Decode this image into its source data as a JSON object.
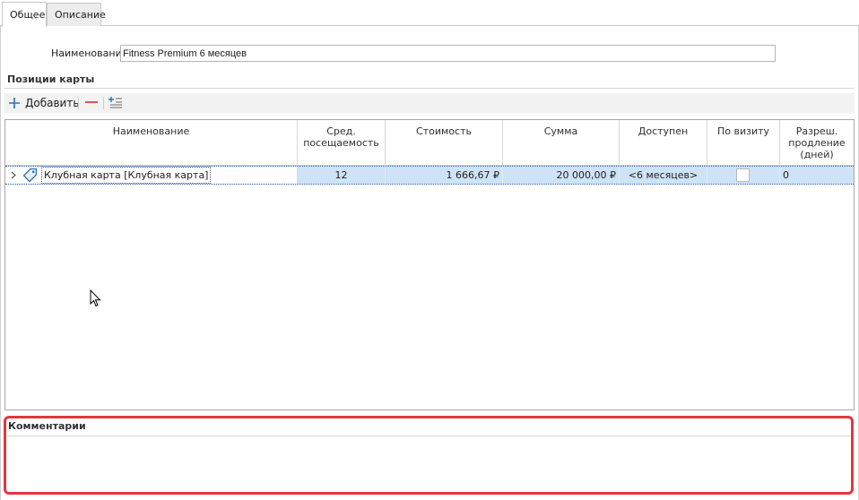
{
  "tabs": [
    {
      "label": "Общее",
      "active": true
    },
    {
      "label": "Описание",
      "active": false
    }
  ],
  "name_field": {
    "label": "Наименование:",
    "value": "Fitness Premium 6 месяцев"
  },
  "positions_group": {
    "title": "Позиции карты"
  },
  "toolbar": {
    "add_label": "Добавить"
  },
  "grid": {
    "columns": [
      "Наименование",
      "Сред. посещаемость",
      "Стоимость",
      "Сумма",
      "Доступен",
      "По визиту",
      "Разреш. продление (дней)"
    ],
    "rows": [
      {
        "name": "Клубная карта [Клубная карта]",
        "attendance": "12",
        "cost": "1 666,67 ₽",
        "sum": "20 000,00 ₽",
        "available": "<6 месяцев>",
        "per_visit": false,
        "extension": "0"
      }
    ]
  },
  "comments_group": {
    "title": "Комментарии"
  },
  "colors": {
    "selection_row": "#cfe3f7",
    "highlight_border": "#e0383e",
    "add_icon": "#2f6fb8",
    "remove_icon": "#e04040"
  }
}
